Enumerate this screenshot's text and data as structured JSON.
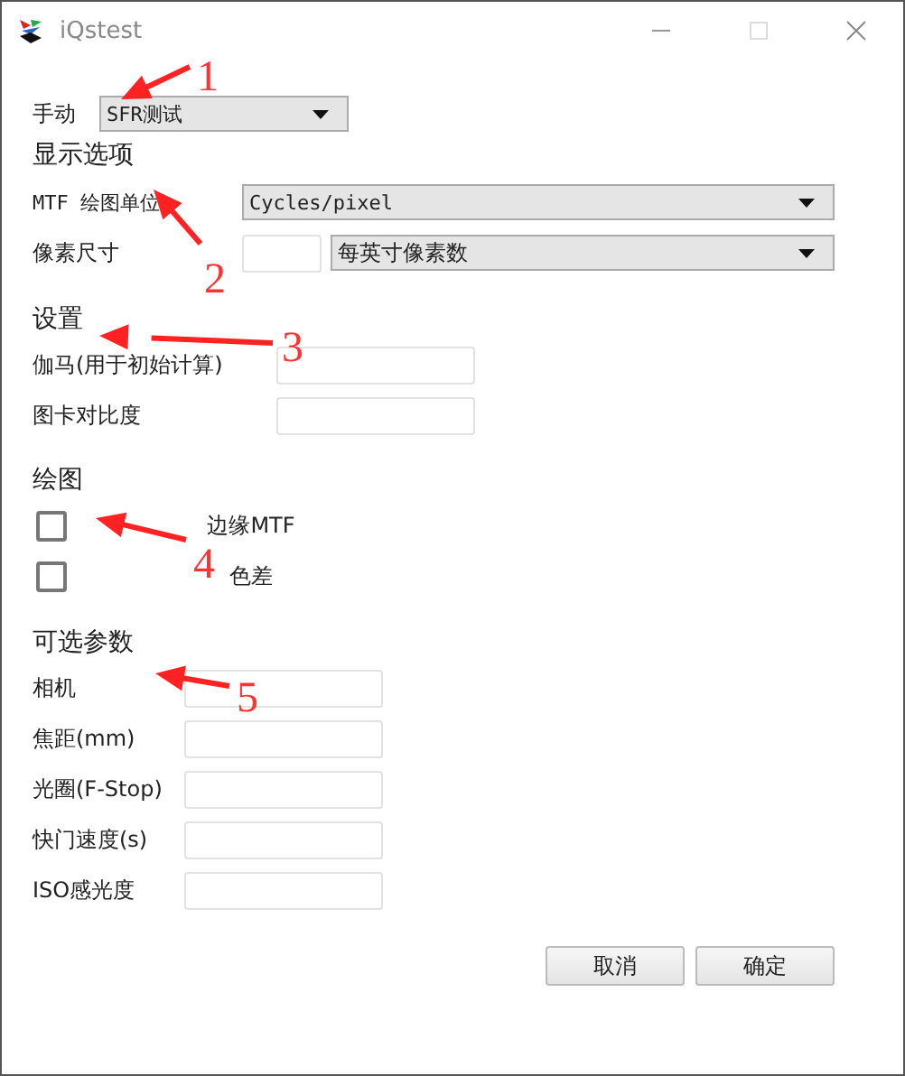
{
  "window": {
    "title": "iQstest"
  },
  "mode": {
    "label": "手动",
    "value": "SFR测试"
  },
  "display_options": {
    "title": "显示选项",
    "mtf_unit": {
      "label": "MTF 绘图单位",
      "value": "Cycles/pixel"
    },
    "pixel_size": {
      "label": "像素尺寸",
      "unit": "每英寸像素数"
    }
  },
  "settings": {
    "title": "设置",
    "fields": [
      {
        "label": "伽马(用于初始计算)"
      },
      {
        "label": "图卡对比度"
      }
    ]
  },
  "plot": {
    "title": "绘图",
    "options": [
      {
        "label": "边缘MTF",
        "checked": false
      },
      {
        "label": "色差",
        "checked": false
      }
    ]
  },
  "optional": {
    "title": "可选参数",
    "fields": [
      {
        "label": "相机"
      },
      {
        "label": "焦距(mm)"
      },
      {
        "label": "光圈(F-Stop)"
      },
      {
        "label": "快门速度(s)"
      },
      {
        "label": "ISO感光度"
      }
    ]
  },
  "buttons": [
    {
      "label": "取消"
    },
    {
      "label": "确定"
    }
  ],
  "annotations": [
    {
      "label": "1"
    },
    {
      "label": "2"
    },
    {
      "label": "3"
    },
    {
      "label": "4"
    },
    {
      "label": "5"
    }
  ]
}
